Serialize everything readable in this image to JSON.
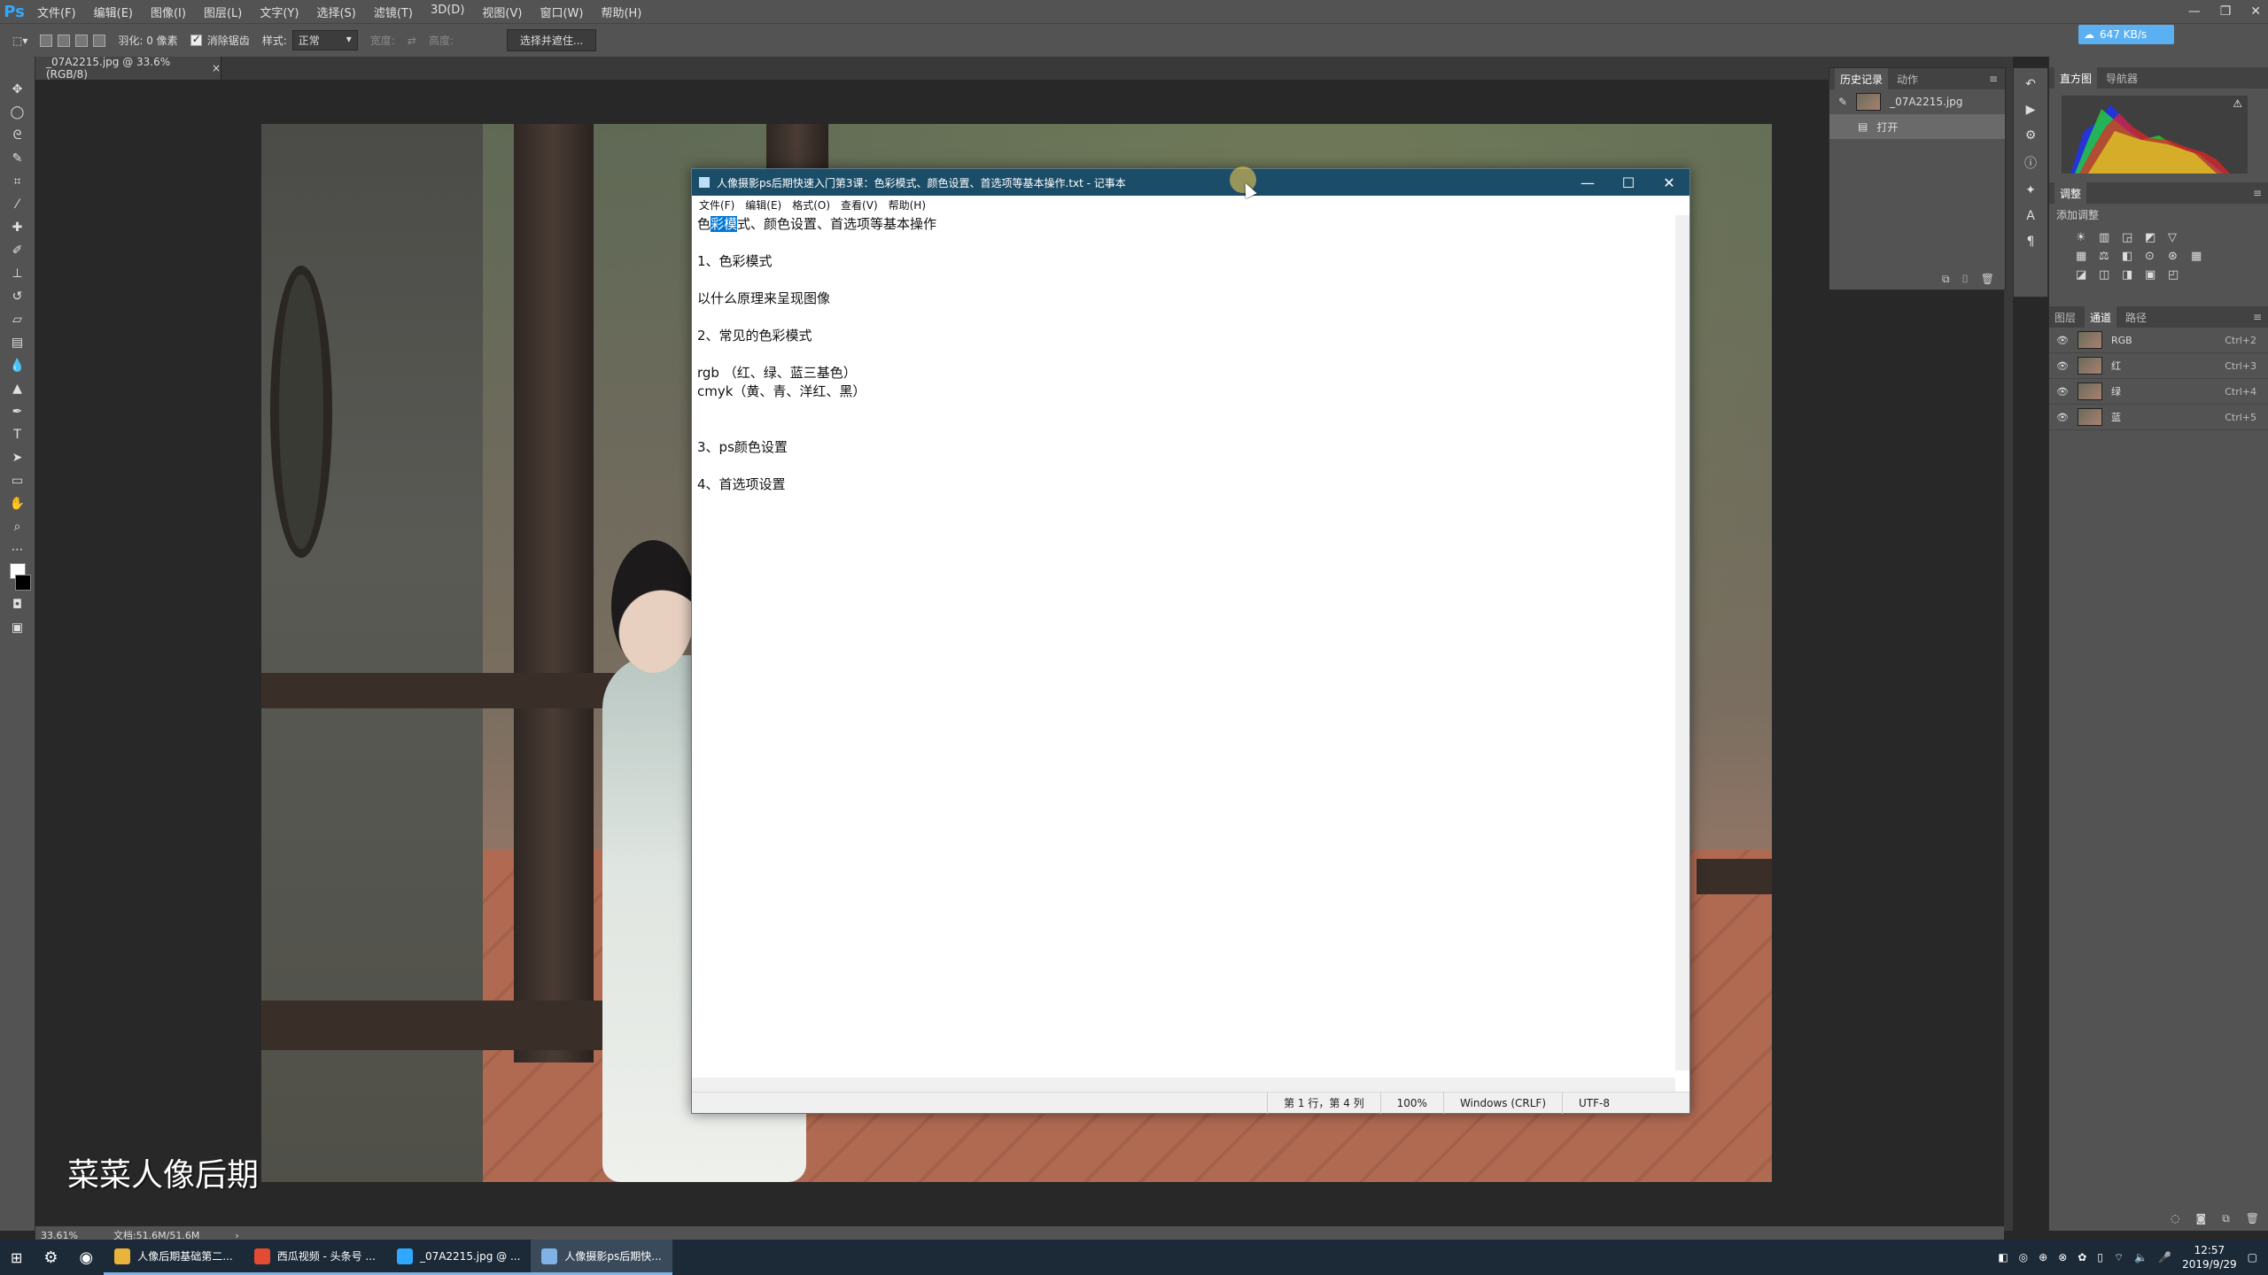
{
  "photoshop": {
    "logo": "Ps",
    "menu": [
      "文件(F)",
      "编辑(E)",
      "图像(I)",
      "图层(L)",
      "文字(Y)",
      "选择(S)",
      "滤镜(T)",
      "3D(D)",
      "视图(V)",
      "窗口(W)",
      "帮助(H)"
    ],
    "options": {
      "feather_label": "羽化: 0 像素",
      "antialias_label": "消除锯齿",
      "style_label": "样式:",
      "style_value": "正常",
      "width_label": "宽度:",
      "height_label": "高度:",
      "select_mask_button": "选择并遮住..."
    },
    "cloud_button": "647 KB/s",
    "doc_tab": "_07A2215.jpg @ 33.6%(RGB/8)",
    "status": {
      "zoom": "33.61%",
      "doc_size": "文档:51.6M/51.6M"
    },
    "watermark": "菜菜人像后期",
    "history_panel": {
      "tabs": [
        "历史记录",
        "动作"
      ],
      "snapshot": "_07A2215.jpg",
      "step": "打开"
    },
    "histogram_panel": {
      "tabs": [
        "直方图",
        "导航器"
      ]
    },
    "adjust_panel": {
      "title": "调整",
      "subtitle": "添加调整"
    },
    "channels_panel": {
      "tabs": [
        "图层",
        "通道",
        "路径"
      ],
      "rows": [
        {
          "name": "RGB",
          "shortcut": "Ctrl+2"
        },
        {
          "name": "红",
          "shortcut": "Ctrl+3"
        },
        {
          "name": "绿",
          "shortcut": "Ctrl+4"
        },
        {
          "name": "蓝",
          "shortcut": "Ctrl+5"
        }
      ]
    }
  },
  "notepad": {
    "title": "人像摄影ps后期快速入门第3课：色彩模式、颜色设置、首选项等基本操作.txt - 记事本",
    "menu": [
      "文件(F)",
      "编辑(E)",
      "格式(O)",
      "查看(V)",
      "帮助(H)"
    ],
    "first_line": {
      "pre": "色",
      "selected": "彩模",
      "post": "式、颜色设置、首选项等基本操作"
    },
    "lines": [
      "",
      "1、色彩模式",
      "",
      "以什么原理来呈现图像",
      "",
      "2、常见的色彩模式",
      "",
      "rgb （红、绿、蓝三基色）",
      "cmyk（黄、青、洋红、黑）",
      "",
      "",
      "3、ps颜色设置",
      "",
      "4、首选项设置"
    ],
    "status": {
      "position": "第 1 行，第 4 列",
      "zoom": "100%",
      "eol": "Windows (CRLF)",
      "encoding": "UTF-8"
    }
  },
  "taskbar": {
    "items": [
      {
        "label": "人像后期基础第二...",
        "color": "#e9b33c"
      },
      {
        "label": "西瓜视频 - 头条号 ...",
        "color": "#e34b33"
      },
      {
        "label": "_07A2215.jpg @ ...",
        "color": "#31a8ff"
      },
      {
        "label": "人像摄影ps后期快...",
        "color": "#7fb3e6"
      }
    ],
    "time": "12:57",
    "date": "2019/9/29"
  }
}
